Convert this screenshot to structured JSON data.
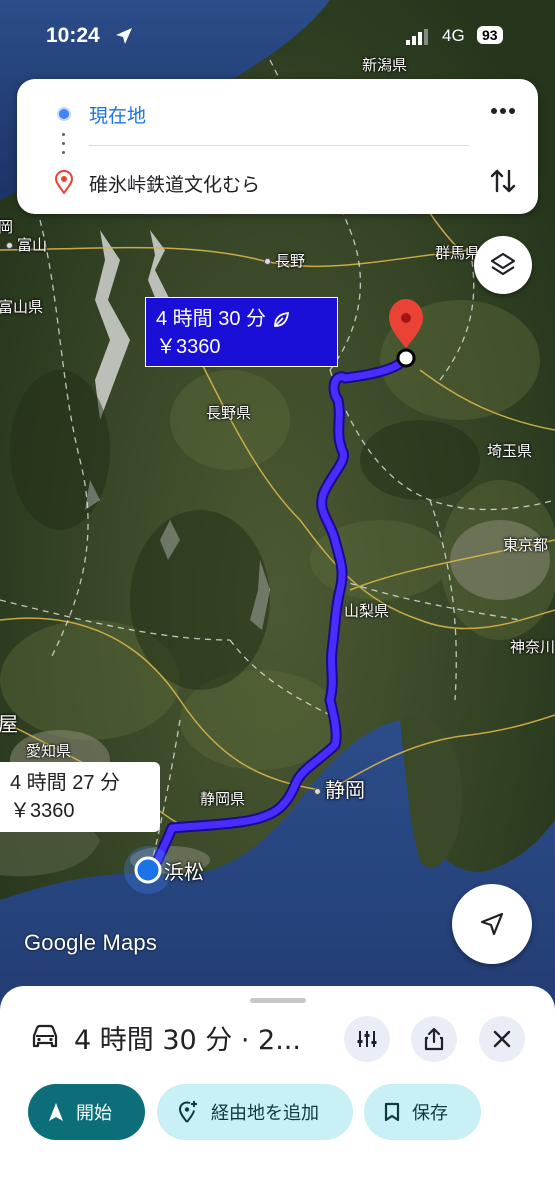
{
  "status_bar": {
    "time": "10:24",
    "network": "4G",
    "battery": "93"
  },
  "directions": {
    "origin": "現在地",
    "destination": "碓氷峠鉄道文化むら"
  },
  "map": {
    "labels": {
      "niigata": "新潟県",
      "toyama": "富山",
      "toyama_pref": "富山県",
      "gunma": "群馬県",
      "nagano": "長野",
      "nagano_pref": "長野県",
      "saitama": "埼玉県",
      "tokyo": "東京都",
      "yamanashi": "山梨県",
      "kanagawa": "神奈川",
      "aichi": "愛知県",
      "shizuoka_pref": "静岡県",
      "shizuoka": "静岡",
      "hamamatsu": "浜松",
      "ya": "屋",
      "oka": "岡"
    },
    "watermark": "Google Maps"
  },
  "routes": {
    "primary": {
      "duration": "4 時間 30 分",
      "toll": "￥3360"
    },
    "alternate": {
      "duration": "4 時間 27 分",
      "toll": "￥3360"
    }
  },
  "sheet": {
    "summary": "4 時間 30 分 · 2...",
    "start_label": "開始",
    "add_stop_label": "経由地を追加",
    "save_label": "保存"
  },
  "colors": {
    "route": "#3b1ff0",
    "accent": "#0b6e78",
    "chip_bg": "#c9f0f6"
  }
}
